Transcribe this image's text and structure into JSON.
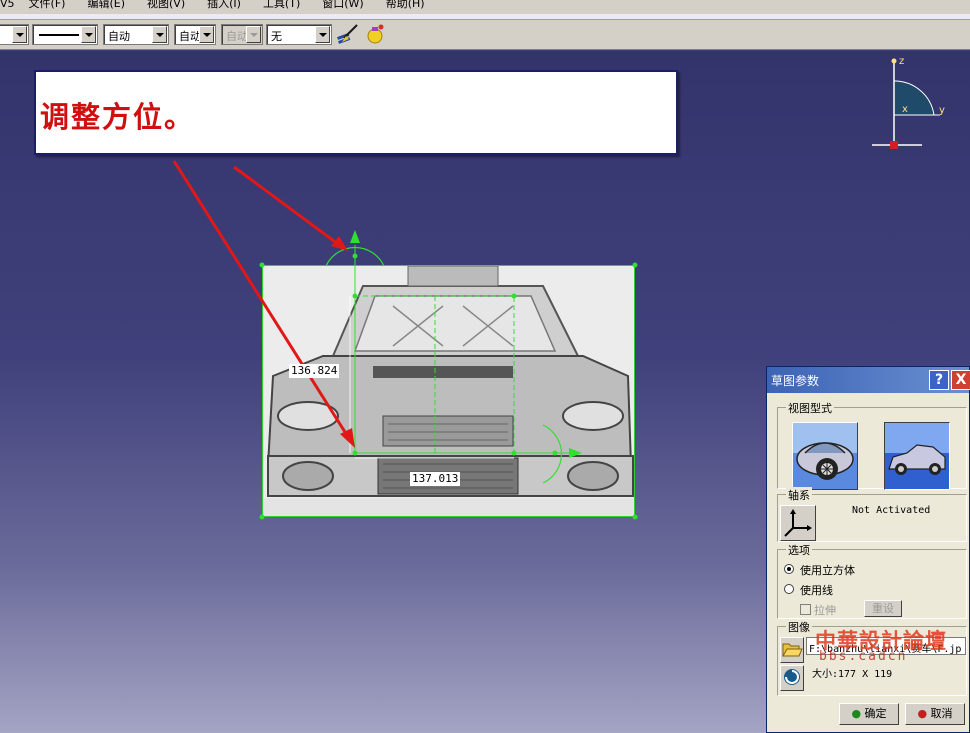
{
  "menu": {
    "items": [
      "V5",
      "文件(F)",
      "编辑(E)",
      "视图(V)",
      "插入(I)",
      "工具(T)",
      "窗口(W)",
      "帮助(H)"
    ]
  },
  "toolbar": {
    "combo_auto1": "自动",
    "combo_auto2": "自动",
    "combo_auto3": "自动",
    "combo_none": "无",
    "brush_icon": "paint-brush-icon",
    "bulb_icon": "light-bulb-icon"
  },
  "annotation": {
    "text": "调整方位。",
    "color": "#d01010"
  },
  "compass": {
    "z": "z",
    "x": "x",
    "y": "y"
  },
  "dimensions": {
    "vertical": "136.824",
    "horizontal": "137.013"
  },
  "dialog": {
    "title": "草图参数",
    "help": "?",
    "close": "X",
    "view_group": "视图型式",
    "axis_group": "轴系",
    "axis_status": "Not Activated",
    "options_group": "选项",
    "opt_cube": "使用立方体",
    "opt_lines": "使用线",
    "stretch": "拉伸",
    "reset": "重设",
    "image_group": "图像",
    "path": "F:\\banzhu\\lianxi\\赛车\\F.jp",
    "size": "大小:177 X 119",
    "ok": "确定",
    "cancel": "取消",
    "watermark": "中華設計論壇",
    "watermark_url": "bbs.cadcn"
  }
}
